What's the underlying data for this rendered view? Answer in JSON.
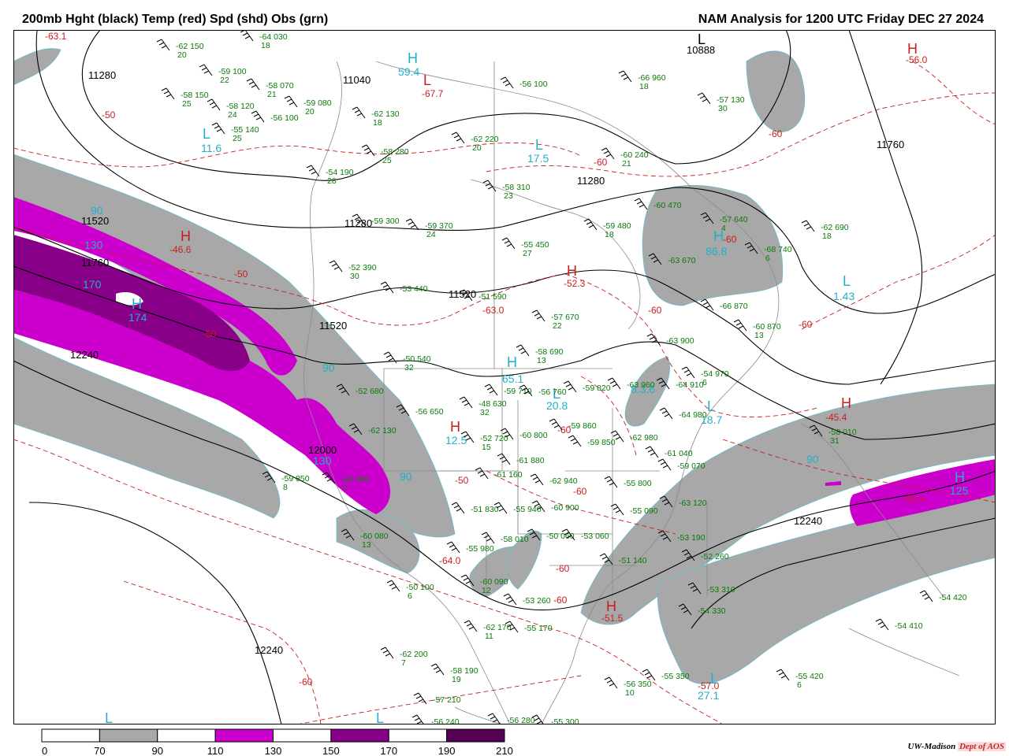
{
  "header": {
    "left_title": "200mb Hght (black) Temp (red) Spd (shd) Obs (grn)",
    "right_title": "NAM Analysis for 1200 UTC Friday  DEC 27 2024"
  },
  "credit": {
    "org": "UW-Madison",
    "dept": "Dept of AOS"
  },
  "colors": {
    "height": "#000000",
    "temp": "#c81e1e",
    "speed_label": "#20b0c8",
    "obs": "#0a7a0a",
    "speed_70_90": "#a8a8a8",
    "speed_110_130": "#cc00cc",
    "speed_150_170": "#880088",
    "speed_190_210": "#550055",
    "border": "#888888"
  },
  "legend": {
    "ticks": [
      "0",
      "70",
      "90",
      "110",
      "130",
      "150",
      "170",
      "190",
      "210"
    ],
    "bins": [
      {
        "from": 0,
        "to": 70,
        "color": "#ffffff"
      },
      {
        "from": 70,
        "to": 90,
        "color": "#a8a8a8"
      },
      {
        "from": 90,
        "to": 110,
        "color": "#ffffff"
      },
      {
        "from": 110,
        "to": 130,
        "color": "#cc00cc"
      },
      {
        "from": 130,
        "to": 150,
        "color": "#ffffff"
      },
      {
        "from": 150,
        "to": 170,
        "color": "#880088"
      },
      {
        "from": 170,
        "to": 190,
        "color": "#ffffff"
      },
      {
        "from": 190,
        "to": 210,
        "color": "#550055"
      }
    ]
  },
  "height_labels": [
    "11280",
    "11040",
    "10888",
    "11760",
    "11280",
    "11520",
    "11760",
    "11520",
    "11520",
    "12240",
    "12000",
    "12240",
    "12240"
  ],
  "temp_labels": [
    "-63.1",
    "-50",
    "-46.6",
    "-50",
    "-50",
    "-67.7",
    "-60",
    "-60",
    "-52.3",
    "-60",
    "-56.0",
    "-60",
    "-63.0",
    "-60",
    "-45.4",
    "-55.4",
    "-50",
    "-60",
    "-64.0",
    "-60",
    "-60",
    "-51.5",
    "-57.0",
    "-60",
    "-60"
  ],
  "speed_labels": [
    "90",
    "130",
    "170",
    "174",
    "59.4",
    "11.6",
    "17.5",
    "86.8",
    "1.43",
    "90",
    "130",
    "90",
    "65.1",
    "20.8",
    "12.5",
    "8.3.6",
    "18.7",
    "90",
    "125",
    "27.1"
  ],
  "centers": [
    {
      "letter": "H",
      "value": "59.4"
    },
    {
      "letter": "L",
      "value": "11.6"
    },
    {
      "letter": "L",
      "value": "17.5"
    },
    {
      "letter": "H",
      "value": "86.8"
    },
    {
      "letter": "L",
      "value": "1.43"
    },
    {
      "letter": "H",
      "value": "174"
    },
    {
      "letter": "H",
      "value": "-46.6"
    },
    {
      "letter": "H",
      "value": "-52.3"
    },
    {
      "letter": "H",
      "value": "-55.4"
    },
    {
      "letter": "H",
      "value": "125"
    },
    {
      "letter": "H",
      "value": "-51.5"
    },
    {
      "letter": "L",
      "value": "27.1"
    },
    {
      "letter": "L",
      "value": "-57.0"
    },
    {
      "letter": "H",
      "value": "-56.0"
    },
    {
      "letter": "L",
      "value": "10888"
    },
    {
      "letter": "H",
      "value": "12.5"
    },
    {
      "letter": "L",
      "value": "20.8"
    },
    {
      "letter": "L",
      "value": "18.7"
    },
    {
      "letter": "L",
      "value": "-67.7"
    },
    {
      "letter": "H",
      "value": "-45.4"
    }
  ],
  "observations": [
    {
      "t": "-64",
      "h": "030",
      "d": "18"
    },
    {
      "t": "-62",
      "h": "150",
      "d": "20"
    },
    {
      "t": "-59",
      "h": "100",
      "d": "22"
    },
    {
      "t": "-58",
      "h": "070",
      "d": "21"
    },
    {
      "t": "-58",
      "h": "150",
      "d": "25"
    },
    {
      "t": "-58",
      "h": "120",
      "d": "24"
    },
    {
      "t": "-56",
      "h": "100",
      "d": ""
    },
    {
      "t": "-55",
      "h": "140",
      "d": "25"
    },
    {
      "t": "-59",
      "h": "080",
      "d": "20"
    },
    {
      "t": "-62",
      "h": "130",
      "d": "18"
    },
    {
      "t": "-58",
      "h": "280",
      "d": "25"
    },
    {
      "t": "-62",
      "h": "220",
      "d": "20"
    },
    {
      "t": "-56",
      "h": "100",
      "d": ""
    },
    {
      "t": "-66",
      "h": "960",
      "d": "18"
    },
    {
      "t": "-57",
      "h": "130",
      "d": "30"
    },
    {
      "t": "-60",
      "h": "240",
      "d": "21"
    },
    {
      "t": "-54",
      "h": "190",
      "d": "28"
    },
    {
      "t": "-58",
      "h": "310",
      "d": "23"
    },
    {
      "t": "-59",
      "h": "300",
      "d": ""
    },
    {
      "t": "-59",
      "h": "370",
      "d": "24"
    },
    {
      "t": "-59",
      "h": "480",
      "d": "18"
    },
    {
      "t": "-60",
      "h": "470",
      "d": ""
    },
    {
      "t": "-57",
      "h": "640",
      "d": "4"
    },
    {
      "t": "-62",
      "h": "690",
      "d": "18"
    },
    {
      "t": "-68",
      "h": "740",
      "d": "6"
    },
    {
      "t": "-52",
      "h": "390",
      "d": "30"
    },
    {
      "t": "-55",
      "h": "450",
      "d": "27"
    },
    {
      "t": "-63",
      "h": "670",
      "d": ""
    },
    {
      "t": "-53",
      "h": "440",
      "d": ""
    },
    {
      "t": "-51",
      "h": "590",
      "d": ""
    },
    {
      "t": "-57",
      "h": "670",
      "d": "22"
    },
    {
      "t": "-66",
      "h": "870",
      "d": ""
    },
    {
      "t": "-60",
      "h": "870",
      "d": "13"
    },
    {
      "t": "-50",
      "h": "540",
      "d": "32"
    },
    {
      "t": "-58",
      "h": "690",
      "d": "13"
    },
    {
      "t": "-63",
      "h": "900",
      "d": ""
    },
    {
      "t": "-54",
      "h": "970",
      "d": "6"
    },
    {
      "t": "-52",
      "h": "680",
      "d": ""
    },
    {
      "t": "-56",
      "h": "650",
      "d": ""
    },
    {
      "t": "-59",
      "h": "710",
      "d": ""
    },
    {
      "t": "-56",
      "h": "760",
      "d": ""
    },
    {
      "t": "-59",
      "h": "820",
      "d": ""
    },
    {
      "t": "-63",
      "h": "960",
      "d": ""
    },
    {
      "t": "-64",
      "h": "910",
      "d": ""
    },
    {
      "t": "-48",
      "h": "630",
      "d": "32"
    },
    {
      "t": "-52",
      "h": "720",
      "d": "15"
    },
    {
      "t": "-60",
      "h": "800",
      "d": ""
    },
    {
      "t": "-59",
      "h": "860",
      "d": ""
    },
    {
      "t": "-62",
      "h": "980",
      "d": ""
    },
    {
      "t": "-64",
      "h": "980",
      "d": ""
    },
    {
      "t": "-59",
      "h": "850",
      "d": ""
    },
    {
      "t": "-61",
      "h": "040",
      "d": ""
    },
    {
      "t": "-59",
      "h": "070",
      "d": ""
    },
    {
      "t": "-58",
      "h": "010",
      "d": "31"
    },
    {
      "t": "-61",
      "h": "880",
      "d": ""
    },
    {
      "t": "-62",
      "h": "940",
      "d": ""
    },
    {
      "t": "-55",
      "h": "800",
      "d": ""
    },
    {
      "t": "-60",
      "h": "900",
      "d": ""
    },
    {
      "t": "-55",
      "h": "090",
      "d": ""
    },
    {
      "t": "-63",
      "h": "120",
      "d": ""
    },
    {
      "t": "-59",
      "h": "850",
      "d": "8"
    },
    {
      "t": "-62",
      "h": "000",
      "d": "7"
    },
    {
      "t": "-51",
      "h": "830",
      "d": ""
    },
    {
      "t": "-55",
      "h": "940",
      "d": ""
    },
    {
      "t": "-50",
      "h": "060",
      "d": ""
    },
    {
      "t": "-53",
      "h": "060",
      "d": ""
    },
    {
      "t": "-60",
      "h": "080",
      "d": "13"
    },
    {
      "t": "-58",
      "h": "010",
      "d": ""
    },
    {
      "t": "-55",
      "h": "980",
      "d": ""
    },
    {
      "t": "-50",
      "h": "100",
      "d": "6"
    },
    {
      "t": "-60",
      "h": "090",
      "d": "12"
    },
    {
      "t": "-53",
      "h": "190",
      "d": ""
    },
    {
      "t": "-52",
      "h": "260",
      "d": ""
    },
    {
      "t": "-53",
      "h": "310",
      "d": ""
    },
    {
      "t": "-54",
      "h": "330",
      "d": ""
    },
    {
      "t": "-54",
      "h": "420",
      "d": ""
    },
    {
      "t": "-54",
      "h": "410",
      "d": ""
    },
    {
      "t": "-62",
      "h": "170",
      "d": "11"
    },
    {
      "t": "-55",
      "h": "170",
      "d": ""
    },
    {
      "t": "-62",
      "h": "200",
      "d": "7"
    },
    {
      "t": "-58",
      "h": "190",
      "d": "19"
    },
    {
      "t": "-57",
      "h": "210",
      "d": ""
    },
    {
      "t": "-56",
      "h": "240",
      "d": ""
    },
    {
      "t": "-56",
      "h": "280",
      "d": ""
    },
    {
      "t": "-55",
      "h": "300",
      "d": ""
    },
    {
      "t": "-56",
      "h": "350",
      "d": "10"
    },
    {
      "t": "-55",
      "h": "350",
      "d": ""
    },
    {
      "t": "-55",
      "h": "420",
      "d": "6"
    },
    {
      "t": "-62",
      "h": "130",
      "d": ""
    },
    {
      "t": "-61",
      "h": "160",
      "d": ""
    },
    {
      "t": "-51",
      "h": "140",
      "d": ""
    },
    {
      "t": "-53",
      "h": "260",
      "d": ""
    }
  ]
}
